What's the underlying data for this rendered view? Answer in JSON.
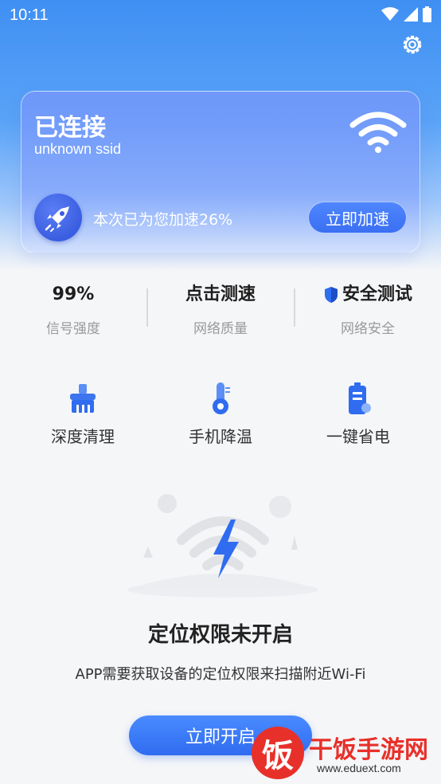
{
  "status_bar": {
    "time": "10:11"
  },
  "card": {
    "title": "已连接",
    "ssid": "unknown ssid",
    "boost_text": "本次已为您加速26%",
    "boost_button": "立即加速"
  },
  "stats": [
    {
      "value": "99%",
      "label": "信号强度"
    },
    {
      "value": "点击测速",
      "label": "网络质量"
    },
    {
      "value": "安全测试",
      "label": "网络安全",
      "icon": "shield-icon"
    }
  ],
  "tools": [
    {
      "label": "深度清理",
      "icon": "broom-icon"
    },
    {
      "label": "手机降温",
      "icon": "thermometer-icon"
    },
    {
      "label": "一键省电",
      "icon": "battery-icon"
    }
  ],
  "permission": {
    "title": "定位权限未开启",
    "description": "APP需要获取设备的定位权限来扫描附近Wi-Fi",
    "button": "立即开启"
  },
  "watermark": {
    "badge": "饭",
    "name": "干饭手游网",
    "url": "www.eduext.com"
  },
  "colors": {
    "accent": "#3a6ff2",
    "hero_top": "#3f8ff3",
    "watermark": "#e8302a"
  }
}
